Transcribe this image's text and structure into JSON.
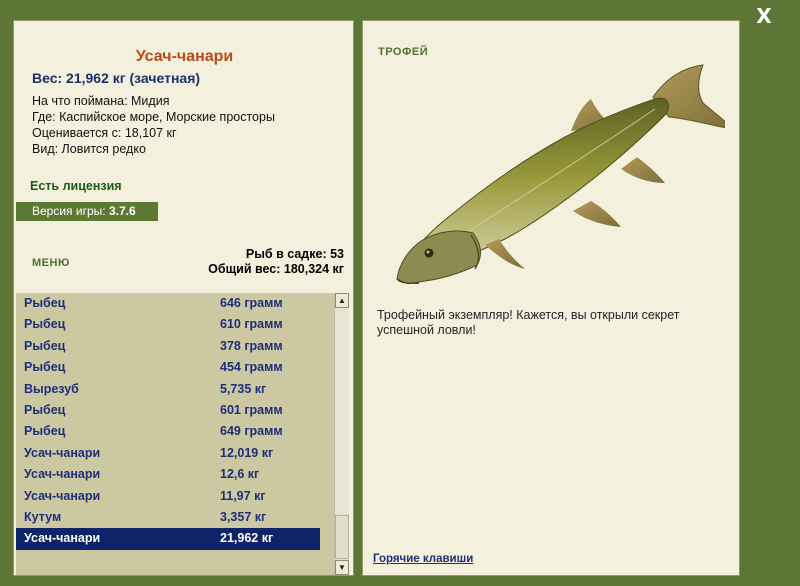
{
  "close_label": "X",
  "fish": {
    "name": "Усач-чанари",
    "weight_line": "Вес: 21,962 кг (зачетная)",
    "caught_on": "На что поймана: Мидия",
    "location": "Где: Каспийское море, Морские просторы",
    "valued_from": "Оценивается с: 18,107 кг",
    "kind": "Вид: Ловится редко"
  },
  "license": "Есть лицензия",
  "version": {
    "label": "Версия игры: ",
    "number": "3.7.6"
  },
  "menu_label": "МЕНЮ",
  "stats": {
    "fish_count": "Рыб в садке: 53",
    "total_weight": "Общий вес: 180,324 кг"
  },
  "catch_list": [
    {
      "name": "Рыбец",
      "weight": "646 грамм"
    },
    {
      "name": "Рыбец",
      "weight": "610 грамм"
    },
    {
      "name": "Рыбец",
      "weight": "378 грамм"
    },
    {
      "name": "Рыбец",
      "weight": "454 грамм"
    },
    {
      "name": "Вырезуб",
      "weight": "5,735 кг"
    },
    {
      "name": "Рыбец",
      "weight": "601 грамм"
    },
    {
      "name": "Рыбец",
      "weight": "649 грамм"
    },
    {
      "name": "Усач-чанари",
      "weight": "12,019 кг"
    },
    {
      "name": "Усач-чанари",
      "weight": "12,6 кг"
    },
    {
      "name": "Усач-чанари",
      "weight": "11,97 кг"
    },
    {
      "name": "Кутум",
      "weight": "3,357 кг"
    },
    {
      "name": "Усач-чанари",
      "weight": "21,962 кг",
      "selected": true
    }
  ],
  "trophy": {
    "label": "ТРОФЕЙ",
    "text": "Трофейный экземпляр! Кажется, вы открыли секрет успешной ловли!"
  },
  "hotkeys_label": "Горячие клавиши",
  "colors": {
    "frame": "#5d7636",
    "panel": "#f3f1de",
    "list_bg": "#ccc8a2",
    "selected_row": "#0f2368",
    "fish_name": "#b64a1d"
  }
}
